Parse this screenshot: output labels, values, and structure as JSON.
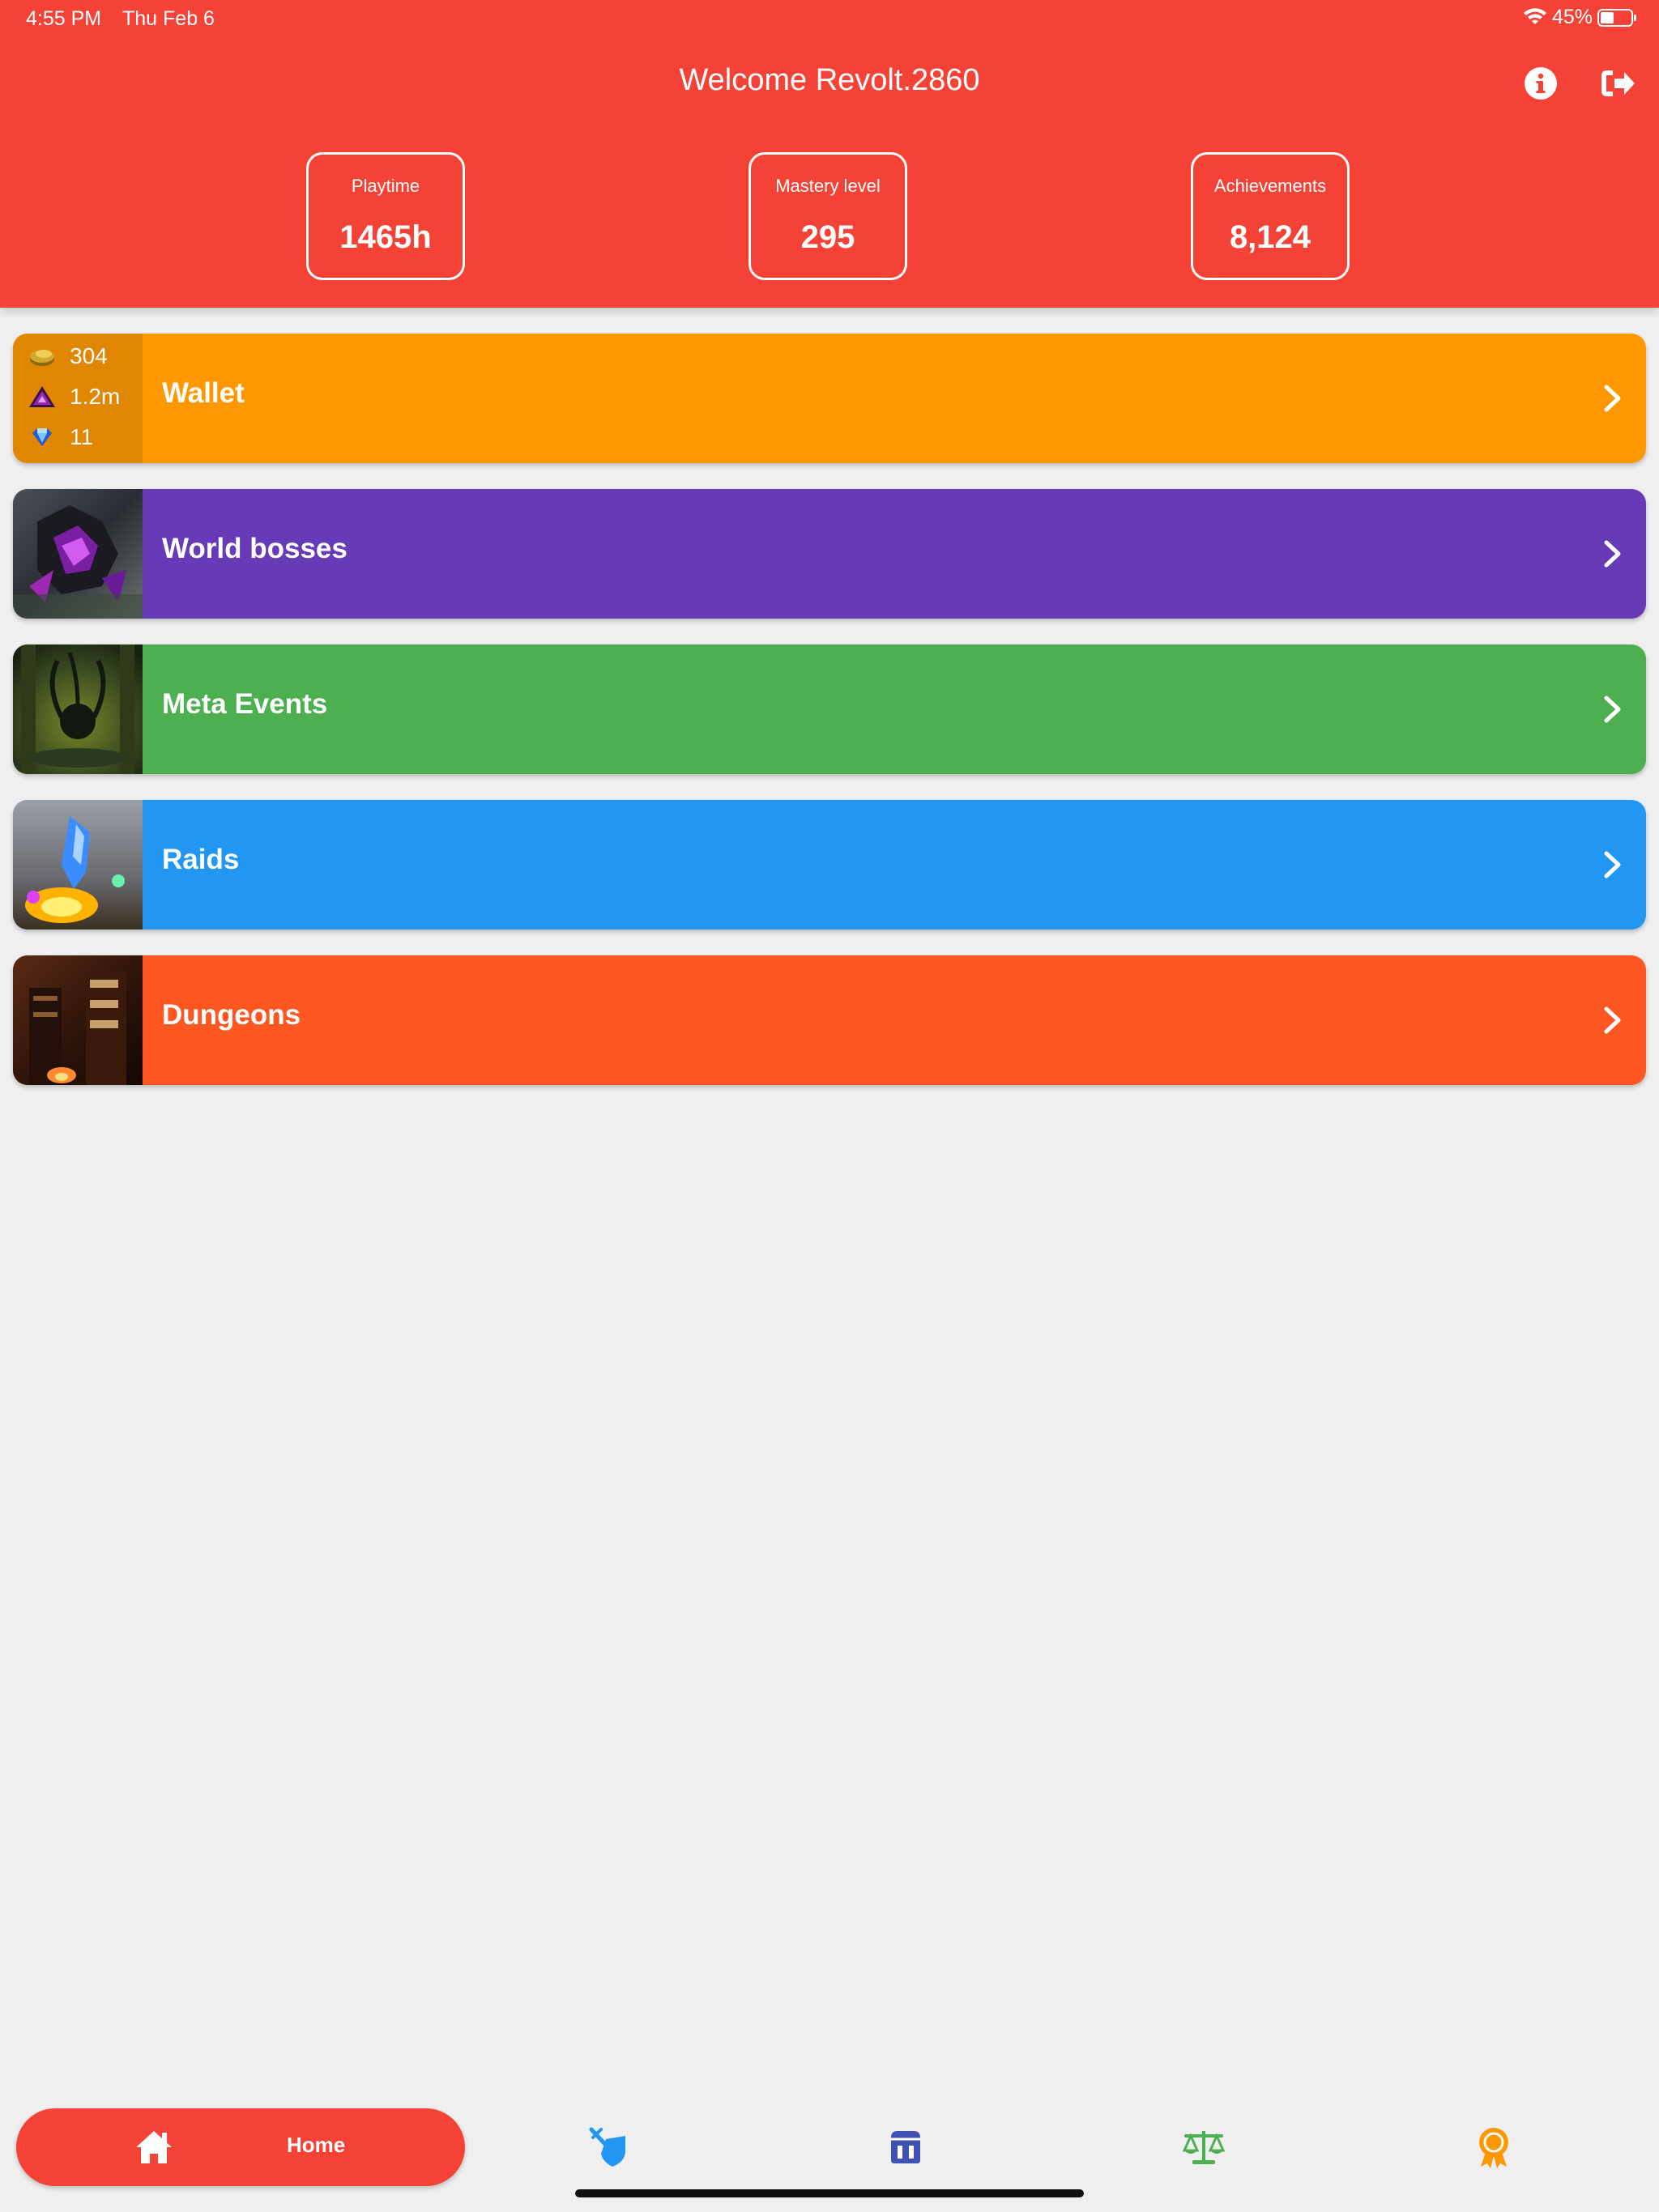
{
  "status_bar": {
    "time": "4:55 PM",
    "date": "Thu Feb 6",
    "battery": "45%",
    "battery_level": 0.45
  },
  "header": {
    "welcome": "Welcome Revolt.2860",
    "info_icon": "info-icon",
    "logout_icon": "logout-icon",
    "stats": [
      {
        "label": "Playtime",
        "value": "1465h"
      },
      {
        "label": "Mastery level",
        "value": "295"
      },
      {
        "label": "Achievements",
        "value": "8,124"
      }
    ]
  },
  "cards": {
    "wallet": {
      "title": "Wallet",
      "color": "#ff9800",
      "currencies": [
        {
          "icon": "gold-coin-icon",
          "value": "304"
        },
        {
          "icon": "karma-icon",
          "value": "1.2m"
        },
        {
          "icon": "gem-icon",
          "value": "11"
        }
      ]
    },
    "world_bosses": {
      "title": "World bosses",
      "color": "#673ab7"
    },
    "meta_events": {
      "title": "Meta Events",
      "color": "#4caf50"
    },
    "raids": {
      "title": "Raids",
      "color": "#2196f3"
    },
    "dungeons": {
      "title": "Dungeons",
      "color": "#ff5722"
    }
  },
  "bottom_nav": {
    "home_label": "Home",
    "items": [
      {
        "icon": "home-icon",
        "color": "#ffffff"
      },
      {
        "icon": "pvp-shield-icon",
        "color": "#2196f3"
      },
      {
        "icon": "bank-icon",
        "color": "#3f51b5"
      },
      {
        "icon": "trading-post-icon",
        "color": "#4caf50"
      },
      {
        "icon": "achievement-badge-icon",
        "color": "#ff9800"
      }
    ]
  },
  "colors": {
    "header": "#f44336",
    "background": "#efefef"
  }
}
